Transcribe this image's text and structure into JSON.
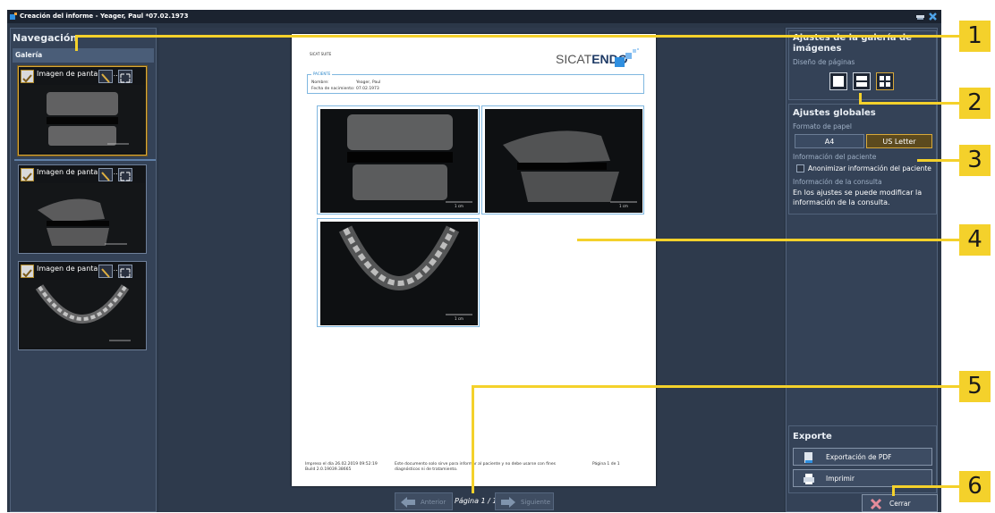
{
  "window": {
    "title": "Creación del informe - Yeager, Paul *07.02.1973"
  },
  "navigation": {
    "title": "Navegación",
    "gallery_header": "Galería",
    "items": [
      {
        "label": "Imagen de pantalla -..."
      },
      {
        "label": "Imagen de pantalla -..."
      },
      {
        "label": "Imagen de pantalla -..."
      }
    ]
  },
  "report": {
    "logo_small": "SICAT SUITE",
    "brand_light": "SICAT",
    "brand_bold": "ENDO",
    "patient_header": "PACIENTE",
    "name_label": "Nombre:",
    "name_value": "Yeager, Paul",
    "dob_label": "Fecha de nacimiento:",
    "dob_value": "07.02.1973",
    "scale_label": "1 cm",
    "footer_printed": "Impreso el día 26.02.2019 09:52:19",
    "footer_build": "Build 2.0.19039.38665",
    "footer_disclaimer": "Este documento solo sirve para informar al paciente y no debe usarse con fines diagnósticos ni de tratamiento.",
    "footer_page": "Página 1 de 1"
  },
  "pager": {
    "prev": "Anterior",
    "label": "Página 1 / 1",
    "next": "Siguiente"
  },
  "gallery_settings": {
    "title": "Ajustes de la galería de imágenes",
    "layout_label": "Diseño de páginas",
    "layouts": [
      "single",
      "two-rows",
      "grid-2x2"
    ],
    "selected_layout": "grid-2x2"
  },
  "global_settings": {
    "title": "Ajustes globales",
    "paper_label": "Formato de papel",
    "paper_options": [
      "A4",
      "US Letter"
    ],
    "paper_selected": "US Letter",
    "patient_info_label": "Información del paciente",
    "anonymize_label": "Anonimizar información del paciente",
    "anonymize_checked": false,
    "consult_label": "Información de la consulta",
    "consult_text": "En los ajustes se puede modificar la información de la consulta."
  },
  "export": {
    "title": "Exporte",
    "pdf_label": "Exportación de PDF",
    "print_label": "Imprimir"
  },
  "close_label": "Cerrar",
  "callouts": [
    "1",
    "2",
    "3",
    "4",
    "5",
    "6"
  ],
  "colors": {
    "accent": "#f4d12b",
    "panel": "#344257",
    "selection": "#d8a93a"
  }
}
